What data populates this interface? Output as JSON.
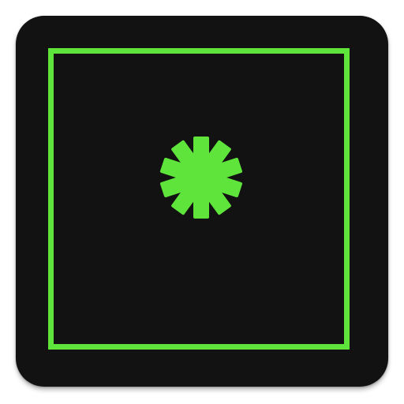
{
  "app_icon": {
    "icon_name": "asterisk-icon",
    "colors": {
      "tile": "#121212",
      "accent": "#5ee43a",
      "background": "#ffffff"
    }
  }
}
